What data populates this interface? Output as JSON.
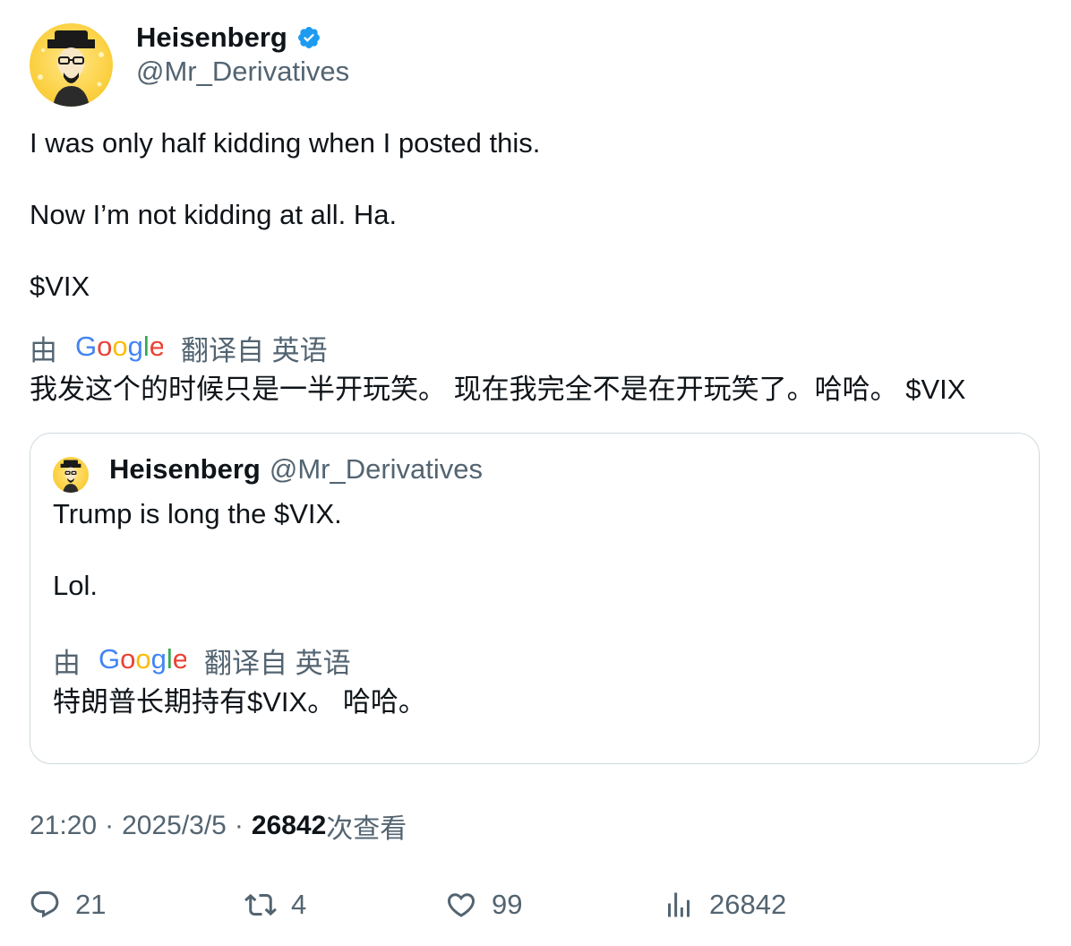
{
  "author": {
    "name": "Heisenberg",
    "handle": "@Mr_Derivatives",
    "verified_color": "#1d9bf0"
  },
  "tweet": {
    "paragraphs": [
      "I was only half kidding when I posted this.",
      "Now I’m not kidding at all. Ha.",
      "$VIX"
    ],
    "translated_prefix": "由",
    "translator_logo": "Google",
    "translated_suffix": "翻译自 英语",
    "translation": "我发这个的时候只是一半开玩笑。 现在我完全不是在开玩笑了。哈哈。 $VIX"
  },
  "quote": {
    "name": "Heisenberg",
    "handle": "@Mr_Derivatives",
    "paragraphs": [
      "Trump is long the $VIX.",
      "Lol."
    ],
    "translated_prefix": "由",
    "translator_logo": "Google",
    "translated_suffix": "翻译自 英语",
    "translation": "特朗普长期持有$VIX。 哈哈。"
  },
  "meta": {
    "time": "21:20",
    "separator": "·",
    "date": "2025/3/5",
    "views_count": "26842",
    "views_label": "次查看"
  },
  "actions": {
    "replies": "21",
    "retweets": "4",
    "likes": "99",
    "views": "26842",
    "icons": [
      "reply-icon",
      "retweet-icon",
      "like-icon",
      "views-icon"
    ]
  },
  "colors": {
    "text": "#0f1419",
    "secondary": "#536471",
    "border": "#cfd9de",
    "google_blue": "#4285f4",
    "google_red": "#ea4335",
    "google_yellow": "#fbbc05",
    "google_green": "#34a853"
  }
}
